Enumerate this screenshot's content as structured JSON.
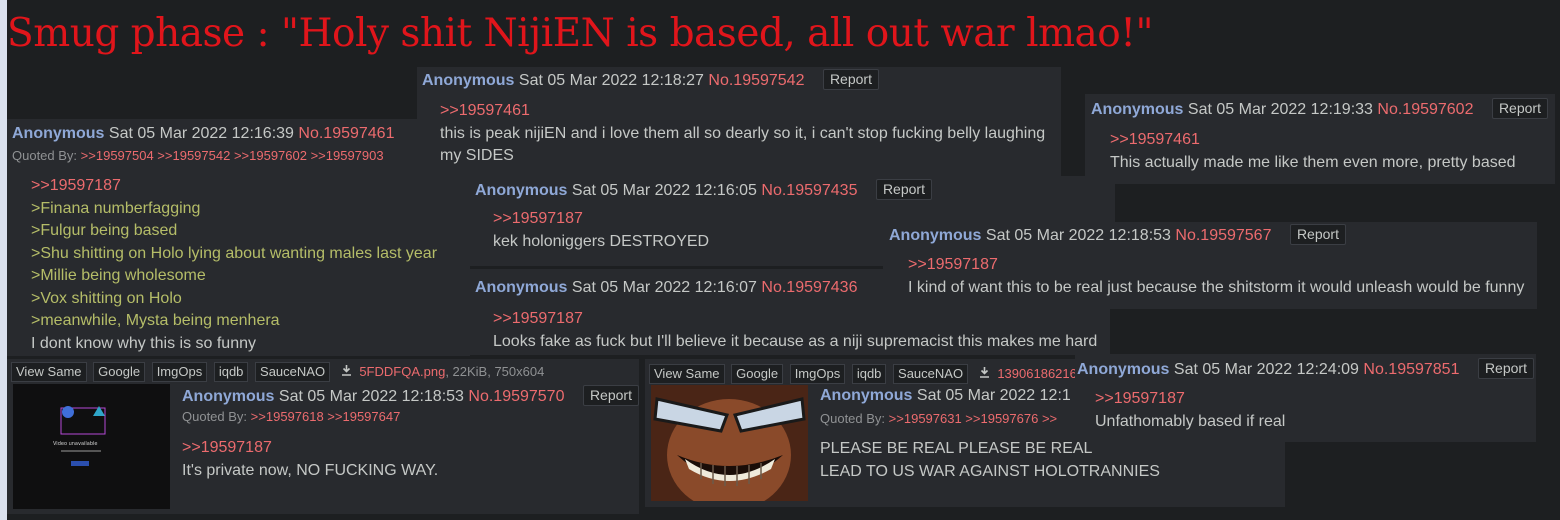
{
  "caption": "Smug phase : \"Holy shit NijiEN is based, all out war lmao!\"",
  "common": {
    "name": "Anonymous",
    "report": "Report"
  },
  "file_tools": [
    "View Same",
    "Google",
    "ImgOps",
    "iqdb",
    "SauceNAO"
  ],
  "colors": {
    "quote": "#ec6b6e",
    "greentext": "#b5bd68",
    "name": "#8fa8d7",
    "caption": "#e0151b",
    "post_bg": "#282a2e"
  },
  "posts": {
    "p461": {
      "date": "Sat 05 Mar 2022 12:16:39",
      "no": "No.19597461",
      "quoted_by_label": "Quoted By:",
      "quoted_by": ">>19597504 >>19597542 >>19597602 >>19597903",
      "lines": [
        ">>19597187",
        ">Finana numberfagging",
        ">Fulgur being based",
        ">Shu shitting on Holo lying about wanting males last year",
        ">Millie being wholesome",
        ">Vox shitting on Holo",
        ">meanwhile, Mysta being menhera",
        "I dont know why this is so funny"
      ]
    },
    "p542": {
      "date": "Sat 05 Mar 2022 12:18:27",
      "no": "No.19597542",
      "lines": [
        ">>19597461",
        "this is peak nijiEN and i love them all so dearly so it, i can't stop fucking belly laughing",
        "my SIDES"
      ]
    },
    "p602": {
      "date": "Sat 05 Mar 2022 12:19:33",
      "no": "No.19597602",
      "lines": [
        ">>19597461",
        "This actually made me like them even more, pretty based"
      ]
    },
    "p435": {
      "date": "Sat 05 Mar 2022 12:16:05",
      "no": "No.19597435",
      "lines": [
        ">>19597187",
        "kek holoniggers DESTROYED"
      ]
    },
    "p567": {
      "date": "Sat 05 Mar 2022 12:18:53",
      "no": "No.19597567",
      "lines": [
        ">>19597187",
        "I kind of want this to be real just because the shitstorm it would unleash would be funny"
      ]
    },
    "p436": {
      "date": "Sat 05 Mar 2022 12:16:07",
      "no": "No.19597436",
      "lines": [
        ">>19597187",
        "Looks fake as fuck but I'll believe it because as a niji supremacist this makes me hard"
      ]
    },
    "p570": {
      "date": "Sat 05 Mar 2022 12:18:53",
      "no": "No.19597570",
      "quoted_by_label": "Quoted By:",
      "quoted_by": ">>19597618 >>19597647",
      "file_name": "5FDDFQA.png",
      "file_meta": ", 22KiB, 750x604",
      "thumb_text": "Video unavailable",
      "lines": [
        ">>19597187",
        "It's private now, NO FUCKING WAY."
      ]
    },
    "pmid": {
      "date": "Sat 05 Mar 2022 12:1",
      "file_name": "13906186216",
      "quoted_by_label": "Quoted By:",
      "quoted_by": ">>19597631 >>19597676 >>",
      "lines": [
        "PLEASE BE REAL PLEASE BE REAL",
        "LEAD TO US WAR AGAINST HOLOTRANNIES"
      ]
    },
    "p851": {
      "date": "Sat 05 Mar 2022 12:24:09",
      "no": "No.19597851",
      "lines": [
        ">>19597187",
        "Unfathomably based if real"
      ]
    }
  }
}
